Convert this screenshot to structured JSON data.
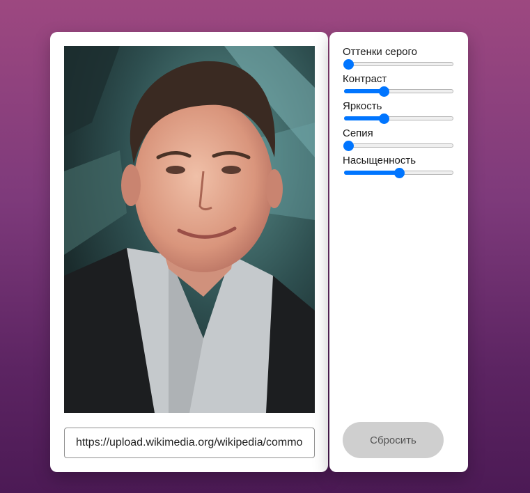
{
  "photo": {
    "alt": "Портрет"
  },
  "url_input": {
    "value": "https://upload.wikimedia.org/wikipedia/commons/"
  },
  "filters": [
    {
      "label": "Оттенки серого",
      "value": 0
    },
    {
      "label": "Контраст",
      "value": 0.35
    },
    {
      "label": "Яркость",
      "value": 0.35
    },
    {
      "label": "Сепия",
      "value": 0
    },
    {
      "label": "Насыщенность",
      "value": 0.5
    }
  ],
  "reset_label": "Сбросить",
  "colors": {
    "accent": "#0075ff",
    "reset_bg": "#cfcfcf"
  }
}
